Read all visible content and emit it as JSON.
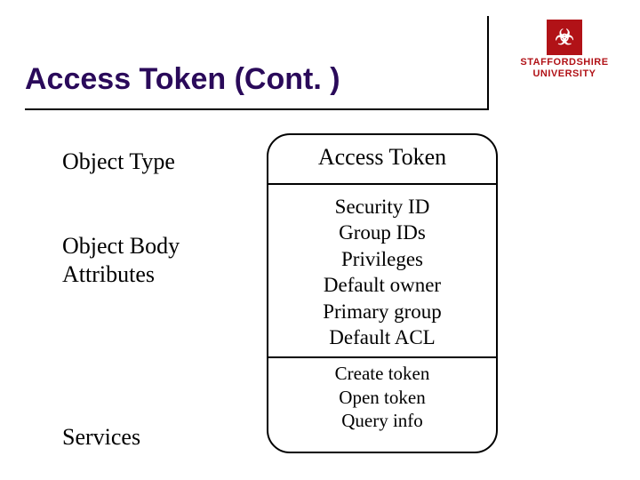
{
  "brand": {
    "name_line1": "STAFFORDSHIRE",
    "name_line2": "UNIVERSITY",
    "glyph": "☣"
  },
  "title": "Access Token (Cont. )",
  "left": {
    "type": "Object Type",
    "body_l1": "Object Body",
    "body_l2": "Attributes",
    "services": "Services"
  },
  "box": {
    "header": "Access Token",
    "attrs": {
      "a1": "Security ID",
      "a2": "Group IDs",
      "a3": "Privileges",
      "a4": "Default owner",
      "a5": "Primary group",
      "a6": "Default ACL"
    },
    "services": {
      "s1": "Create token",
      "s2": "Open token",
      "s3": "Query info"
    }
  }
}
